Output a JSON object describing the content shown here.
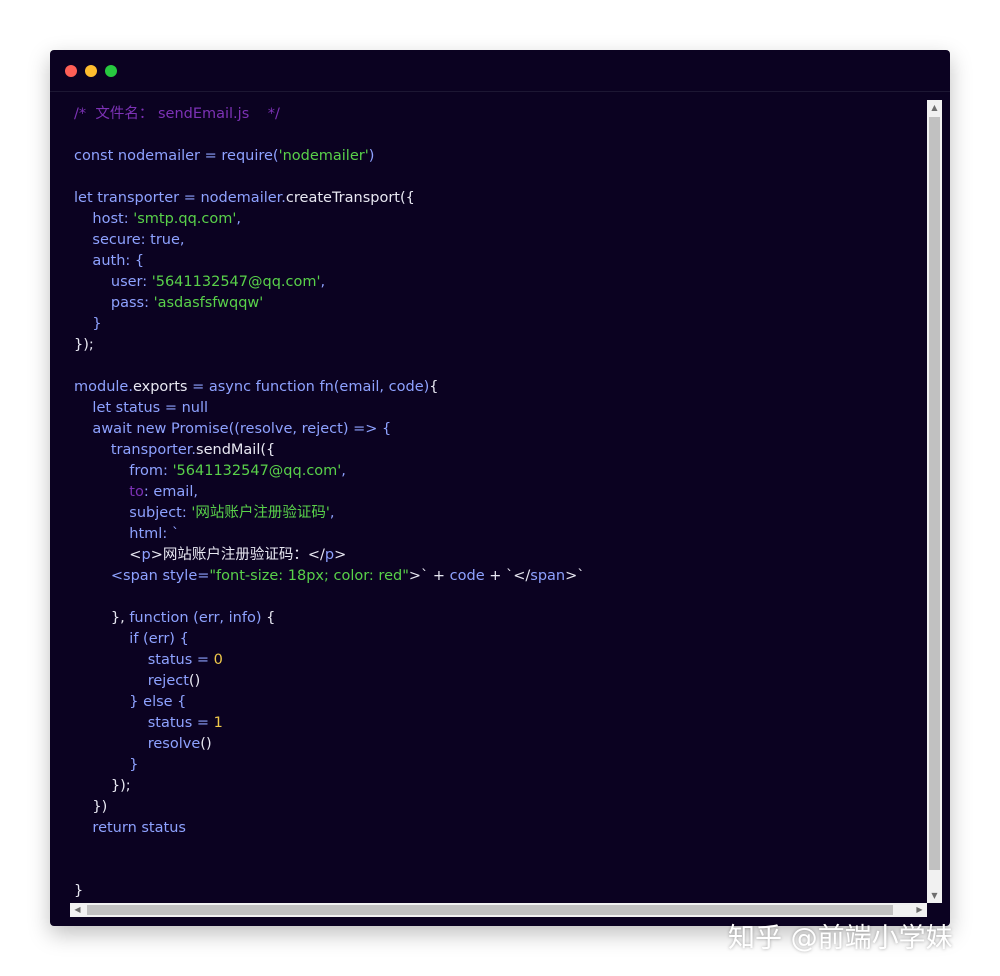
{
  "window": {
    "controls": [
      "close",
      "minimize",
      "maximize"
    ]
  },
  "code": {
    "filename_comment": "/*  文件名： sendEmail.js    */",
    "lines": [
      [
        [
          "c",
          "/*  文件名： sendEmail.js    */"
        ]
      ],
      [],
      [
        [
          "k",
          "const nodemailer = require("
        ],
        [
          "s",
          "'nodemailer'"
        ],
        [
          "k",
          ")"
        ]
      ],
      [],
      [
        [
          "k",
          "let transporter = nodemailer."
        ],
        [
          "w",
          "createTransport({"
        ]
      ],
      [
        [
          "k",
          "    host: "
        ],
        [
          "s",
          "'smtp.qq.com'"
        ],
        [
          "k",
          ","
        ]
      ],
      [
        [
          "k",
          "    secure: true,"
        ]
      ],
      [
        [
          "k",
          "    auth: {"
        ]
      ],
      [
        [
          "k",
          "        user: "
        ],
        [
          "s",
          "'5641132547@qq.com'"
        ],
        [
          "k",
          ","
        ]
      ],
      [
        [
          "k",
          "        pass: "
        ],
        [
          "s",
          "'asdasfsfwqqw'"
        ]
      ],
      [
        [
          "k",
          "    }"
        ]
      ],
      [
        [
          "w",
          "});"
        ]
      ],
      [],
      [
        [
          "k",
          "module."
        ],
        [
          "w",
          "exports"
        ],
        [
          "k",
          " = async function fn(email, code)"
        ],
        [
          "w",
          "{"
        ]
      ],
      [
        [
          "k",
          "    let status = null"
        ]
      ],
      [
        [
          "k",
          "    await new Promise((resolve, reject) => {"
        ]
      ],
      [
        [
          "k",
          "        transporter."
        ],
        [
          "w",
          "sendMail({"
        ]
      ],
      [
        [
          "k",
          "            from: "
        ],
        [
          "s",
          "'5641132547@qq.com'"
        ],
        [
          "k",
          ","
        ]
      ],
      [
        [
          "c",
          "            to"
        ],
        [
          "k",
          ": email,"
        ]
      ],
      [
        [
          "k",
          "            subject: "
        ],
        [
          "s",
          "'网站账户注册验证码'"
        ],
        [
          "k",
          ","
        ]
      ],
      [
        [
          "k",
          "            html: `"
        ]
      ],
      [
        [
          "w",
          "            <"
        ],
        [
          "k",
          "p"
        ],
        [
          "w",
          ">网站账户注册验证码：</"
        ],
        [
          "k",
          "p"
        ],
        [
          "w",
          ">"
        ]
      ],
      [
        [
          "k",
          "        <span style="
        ],
        [
          "s",
          "\"font-size: 18px; color: red\""
        ],
        [
          "w",
          ">` + "
        ],
        [
          "k",
          "code"
        ],
        [
          "w",
          " + `</"
        ],
        [
          "k",
          "span"
        ],
        [
          "w",
          ">`"
        ]
      ],
      [],
      [
        [
          "w",
          "        }, "
        ],
        [
          "k",
          "function (err, info) "
        ],
        [
          "w",
          "{"
        ]
      ],
      [
        [
          "k",
          "            if (err) {"
        ]
      ],
      [
        [
          "k",
          "                status = "
        ],
        [
          "n",
          "0"
        ]
      ],
      [
        [
          "k",
          "                reject"
        ],
        [
          "w",
          "()"
        ]
      ],
      [
        [
          "k",
          "            } else {"
        ]
      ],
      [
        [
          "k",
          "                status = "
        ],
        [
          "n",
          "1"
        ]
      ],
      [
        [
          "k",
          "                resolve"
        ],
        [
          "w",
          "()"
        ]
      ],
      [
        [
          "k",
          "            }"
        ]
      ],
      [
        [
          "w",
          "        });"
        ]
      ],
      [
        [
          "w",
          "    })"
        ]
      ],
      [
        [
          "k",
          "    return status"
        ]
      ],
      [],
      [],
      [
        [
          "w",
          "}"
        ]
      ]
    ]
  },
  "watermark": "知乎 @前端小学妹"
}
